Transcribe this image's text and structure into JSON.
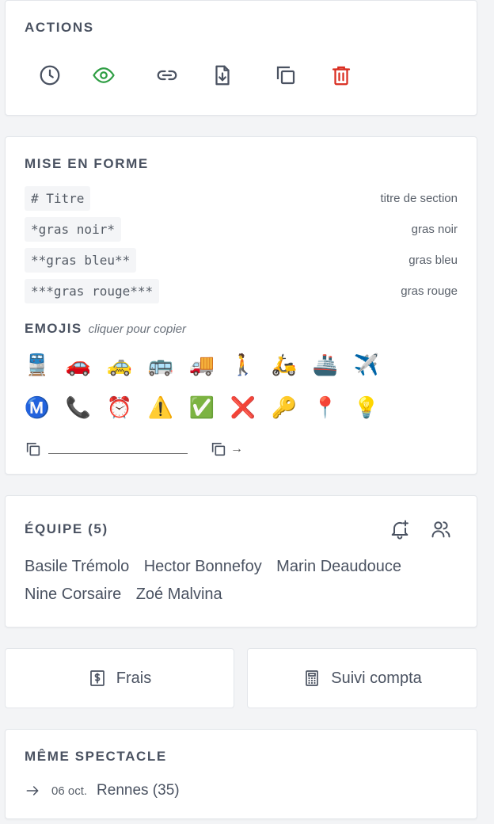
{
  "actions": {
    "title": "ACTIONS",
    "icons": [
      "clock-icon",
      "eye-icon",
      "link-icon",
      "file-download-icon",
      "copy-icon",
      "trash-icon"
    ],
    "colors": {
      "eye": "#2f9e44",
      "trash": "#d92d20",
      "default": "#4a5261"
    }
  },
  "format": {
    "title": "MISE EN FORME",
    "rows": [
      {
        "code": "# Titre",
        "desc": "titre de section"
      },
      {
        "code": "*gras noir*",
        "desc": "gras noir"
      },
      {
        "code": "**gras bleu**",
        "desc": "gras bleu"
      },
      {
        "code": "***gras rouge***",
        "desc": "gras rouge"
      }
    ],
    "emojis_title": "EMOJIS",
    "emojis_hint": "cliquer pour copier",
    "emojis_row1": [
      "🚆",
      "🚗",
      "🚕",
      "🚌",
      "🚚",
      "🚶",
      "🛵",
      "🚢",
      "✈️"
    ],
    "emojis_row2": [
      "Ⓜ️",
      "📞",
      "⏰",
      "⚠️",
      "✅",
      "❌",
      "🔑",
      "📍",
      "💡"
    ],
    "copy_arrow": "→"
  },
  "team": {
    "title": "ÉQUIPE (5)",
    "members": [
      "Basile Trémolo",
      "Hector Bonnefoy",
      "Marin Deaudouce",
      "Nine Corsaire",
      "Zoé Malvina"
    ]
  },
  "buttons": {
    "frais": "Frais",
    "compta": "Suivi compta"
  },
  "same_show": {
    "title": "MÊME SPECTACLE",
    "date": "06 oct.",
    "city": "Rennes (35)"
  }
}
